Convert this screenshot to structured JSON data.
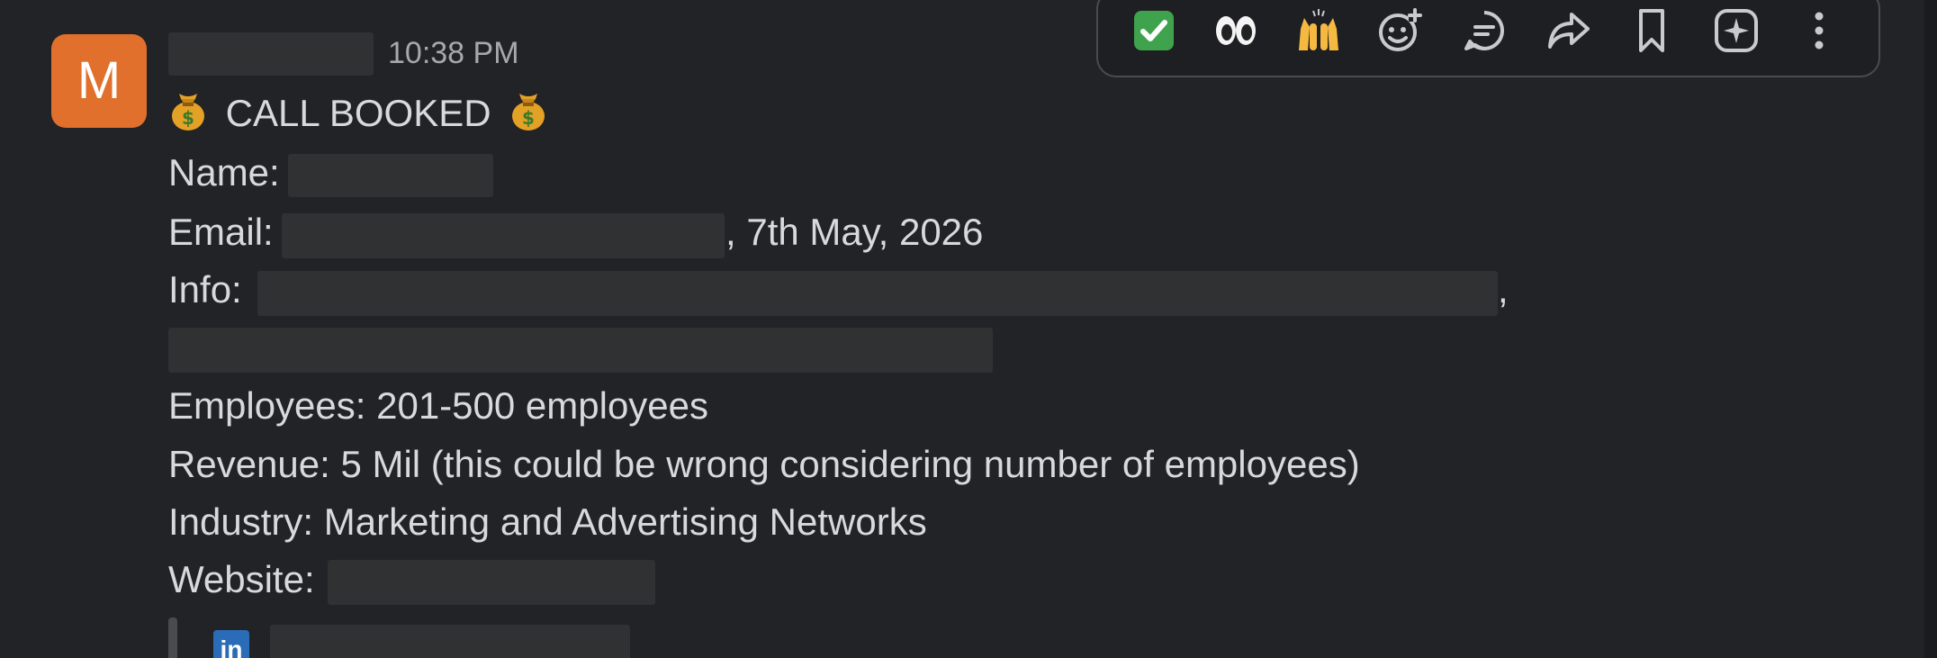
{
  "message": {
    "avatar_initial": "M",
    "timestamp": "10:38 PM",
    "title": "CALL BOOKED",
    "title_emoji": "money-bag",
    "name_label": "Name:",
    "email_label": "Email:",
    "email_suffix": ", 7th May, 2026",
    "info_label": "Info:",
    "info_suffix": ",",
    "employees": "Employees: 201-500 employees",
    "revenue": "Revenue: 5 Mil (this could be wrong considering number of employees)",
    "industry": "Industry: Marketing and Advertising Networks",
    "website_label": "Website:"
  },
  "toolbar": {
    "items": [
      {
        "name": "check-mark-emoji"
      },
      {
        "name": "eyes-emoji"
      },
      {
        "name": "raised-hands-emoji"
      },
      {
        "name": "add-reaction-icon"
      },
      {
        "name": "reply-in-thread-icon"
      },
      {
        "name": "share-forward-icon"
      },
      {
        "name": "bookmark-icon"
      },
      {
        "name": "ai-sparkle-icon"
      },
      {
        "name": "more-actions-icon"
      }
    ]
  },
  "colors": {
    "background": "#222327",
    "avatar": "#e0702b",
    "text": "#d8d9da",
    "muted": "#a7a8ab",
    "linkedin": "#2b6cb8"
  }
}
